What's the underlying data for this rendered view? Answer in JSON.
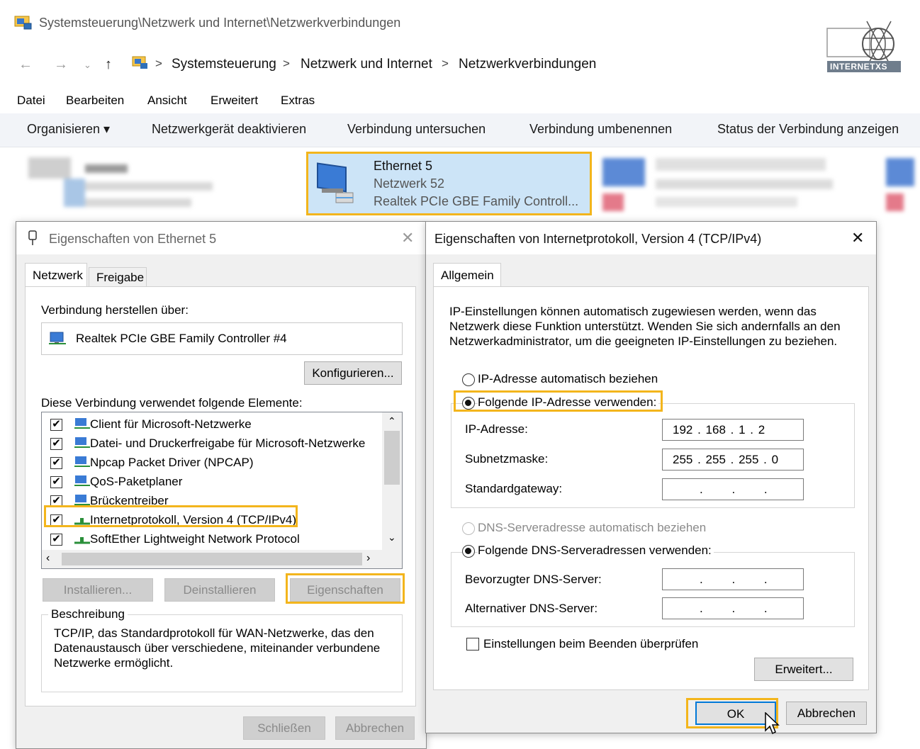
{
  "window": {
    "title": "Systemsteuerung\\Netzwerk und Internet\\Netzwerkverbindungen",
    "logo_text": "INTERNETXS"
  },
  "address_bar": {
    "crumbs": [
      "Systemsteuerung",
      "Netzwerk und Internet",
      "Netzwerkverbindungen"
    ],
    "separator": ">"
  },
  "menu": {
    "items": [
      "Datei",
      "Bearbeiten",
      "Ansicht",
      "Erweitert",
      "Extras"
    ]
  },
  "commands": {
    "organize": "Organisieren ▾",
    "items": [
      "Netzwerkgerät deaktivieren",
      "Verbindung untersuchen",
      "Verbindung umbenennen",
      "Status der Verbindung anzeigen"
    ]
  },
  "adapter": {
    "name": "Ethernet 5",
    "network": "Netzwerk 52",
    "device": "Realtek PCIe GBE Family Controll..."
  },
  "props_dialog": {
    "title": "Eigenschaften von Ethernet 5",
    "tabs": [
      "Netzwerk",
      "Freigabe"
    ],
    "connect_via_label": "Verbindung herstellen über:",
    "controller": "Realtek PCIe GBE Family Controller #4",
    "configure_btn": "Konfigurieren...",
    "elements_label": "Diese Verbindung verwendet folgende Elemente:",
    "elements": [
      "Client für Microsoft-Netzwerke",
      "Datei- und Druckerfreigabe für Microsoft-Netzwerke",
      "Npcap Packet Driver (NPCAP)",
      "QoS-Paketplaner",
      "Brückentreiber",
      "Internetprotokoll, Version 4 (TCP/IPv4)",
      "SoftEther Lightweight Network Protocol"
    ],
    "install_btn": "Installieren...",
    "uninstall_btn": "Deinstallieren",
    "properties_btn": "Eigenschaften",
    "description_label": "Beschreibung",
    "description": "TCP/IP, das Standardprotokoll für WAN-Netzwerke, das den Datenaustausch über verschiedene, miteinander verbundene Netzwerke ermöglicht.",
    "close_btn": "Schließen",
    "cancel_btn": "Abbrechen"
  },
  "ipv4_dialog": {
    "title": "Eigenschaften von Internetprotokoll, Version 4 (TCP/IPv4)",
    "tab": "Allgemein",
    "intro": "IP-Einstellungen können automatisch zugewiesen werden, wenn das Netzwerk diese Funktion unterstützt. Wenden Sie sich andernfalls an den Netzwerkadministrator, um die geeigneten IP-Einstellungen zu beziehen.",
    "auto_ip": "IP-Adresse automatisch beziehen",
    "manual_ip": "Folgende IP-Adresse verwenden:",
    "ip_label": "IP-Adresse:",
    "ip_value": "192 . 168 . 1 . 2",
    "subnet_label": "Subnetzmaske:",
    "subnet_value": "255 . 255 . 255 . 0",
    "gateway_label": "Standardgateway:",
    "empty_ip": ". . .",
    "auto_dns": "DNS-Serveradresse automatisch beziehen",
    "manual_dns": "Folgende DNS-Serveradressen verwenden:",
    "pref_dns_label": "Bevorzugter DNS-Server:",
    "alt_dns_label": "Alternativer DNS-Server:",
    "validate_label": "Einstellungen beim Beenden überprüfen",
    "advanced_btn": "Erweitert...",
    "ok_btn": "OK",
    "cancel_btn": "Abbrechen"
  },
  "colors": {
    "highlight": "#f3b51c",
    "accent": "#0078d7"
  }
}
